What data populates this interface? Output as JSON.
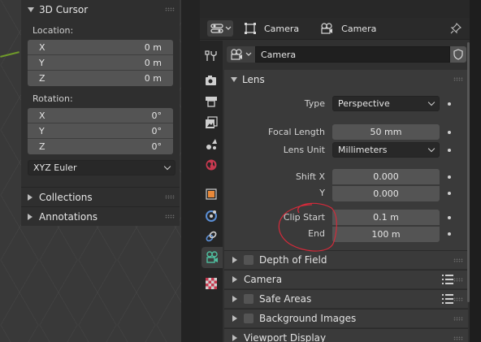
{
  "npanel": {
    "section_title": "3D Cursor",
    "location_label": "Location:",
    "location": [
      {
        "axis": "X",
        "value": "0 m"
      },
      {
        "axis": "Y",
        "value": "0 m"
      },
      {
        "axis": "Z",
        "value": "0 m"
      }
    ],
    "rotation_label": "Rotation:",
    "rotation": [
      {
        "axis": "X",
        "value": "0°"
      },
      {
        "axis": "Y",
        "value": "0°"
      },
      {
        "axis": "Z",
        "value": "0°"
      }
    ],
    "rotation_mode": "XYZ Euler",
    "collections": "Collections",
    "annotations": "Annotations"
  },
  "header": {
    "object_name": "Camera",
    "data_name": "Camera"
  },
  "data_block": {
    "name": "Camera"
  },
  "lens": {
    "title": "Lens",
    "type_label": "Type",
    "type_value": "Perspective",
    "focal_label": "Focal Length",
    "focal_value": "50 mm",
    "unit_label": "Lens Unit",
    "unit_value": "Millimeters",
    "shiftx_label": "Shift X",
    "shiftx_value": "0.000",
    "shifty_label": "Y",
    "shifty_value": "0.000",
    "clipstart_label": "Clip Start",
    "clipstart_value": "0.1 m",
    "clipend_label": "End",
    "clipend_value": "100 m"
  },
  "subpanels": {
    "dof": "Depth of Field",
    "camera": "Camera",
    "safe_areas": "Safe Areas",
    "background_images": "Background Images",
    "viewport_display": "Viewport Display"
  },
  "colors": {
    "annotation": "#d42a3a",
    "object_tab_accent": "#e8893a",
    "camera_tab_accent": "#4fc0a0"
  }
}
